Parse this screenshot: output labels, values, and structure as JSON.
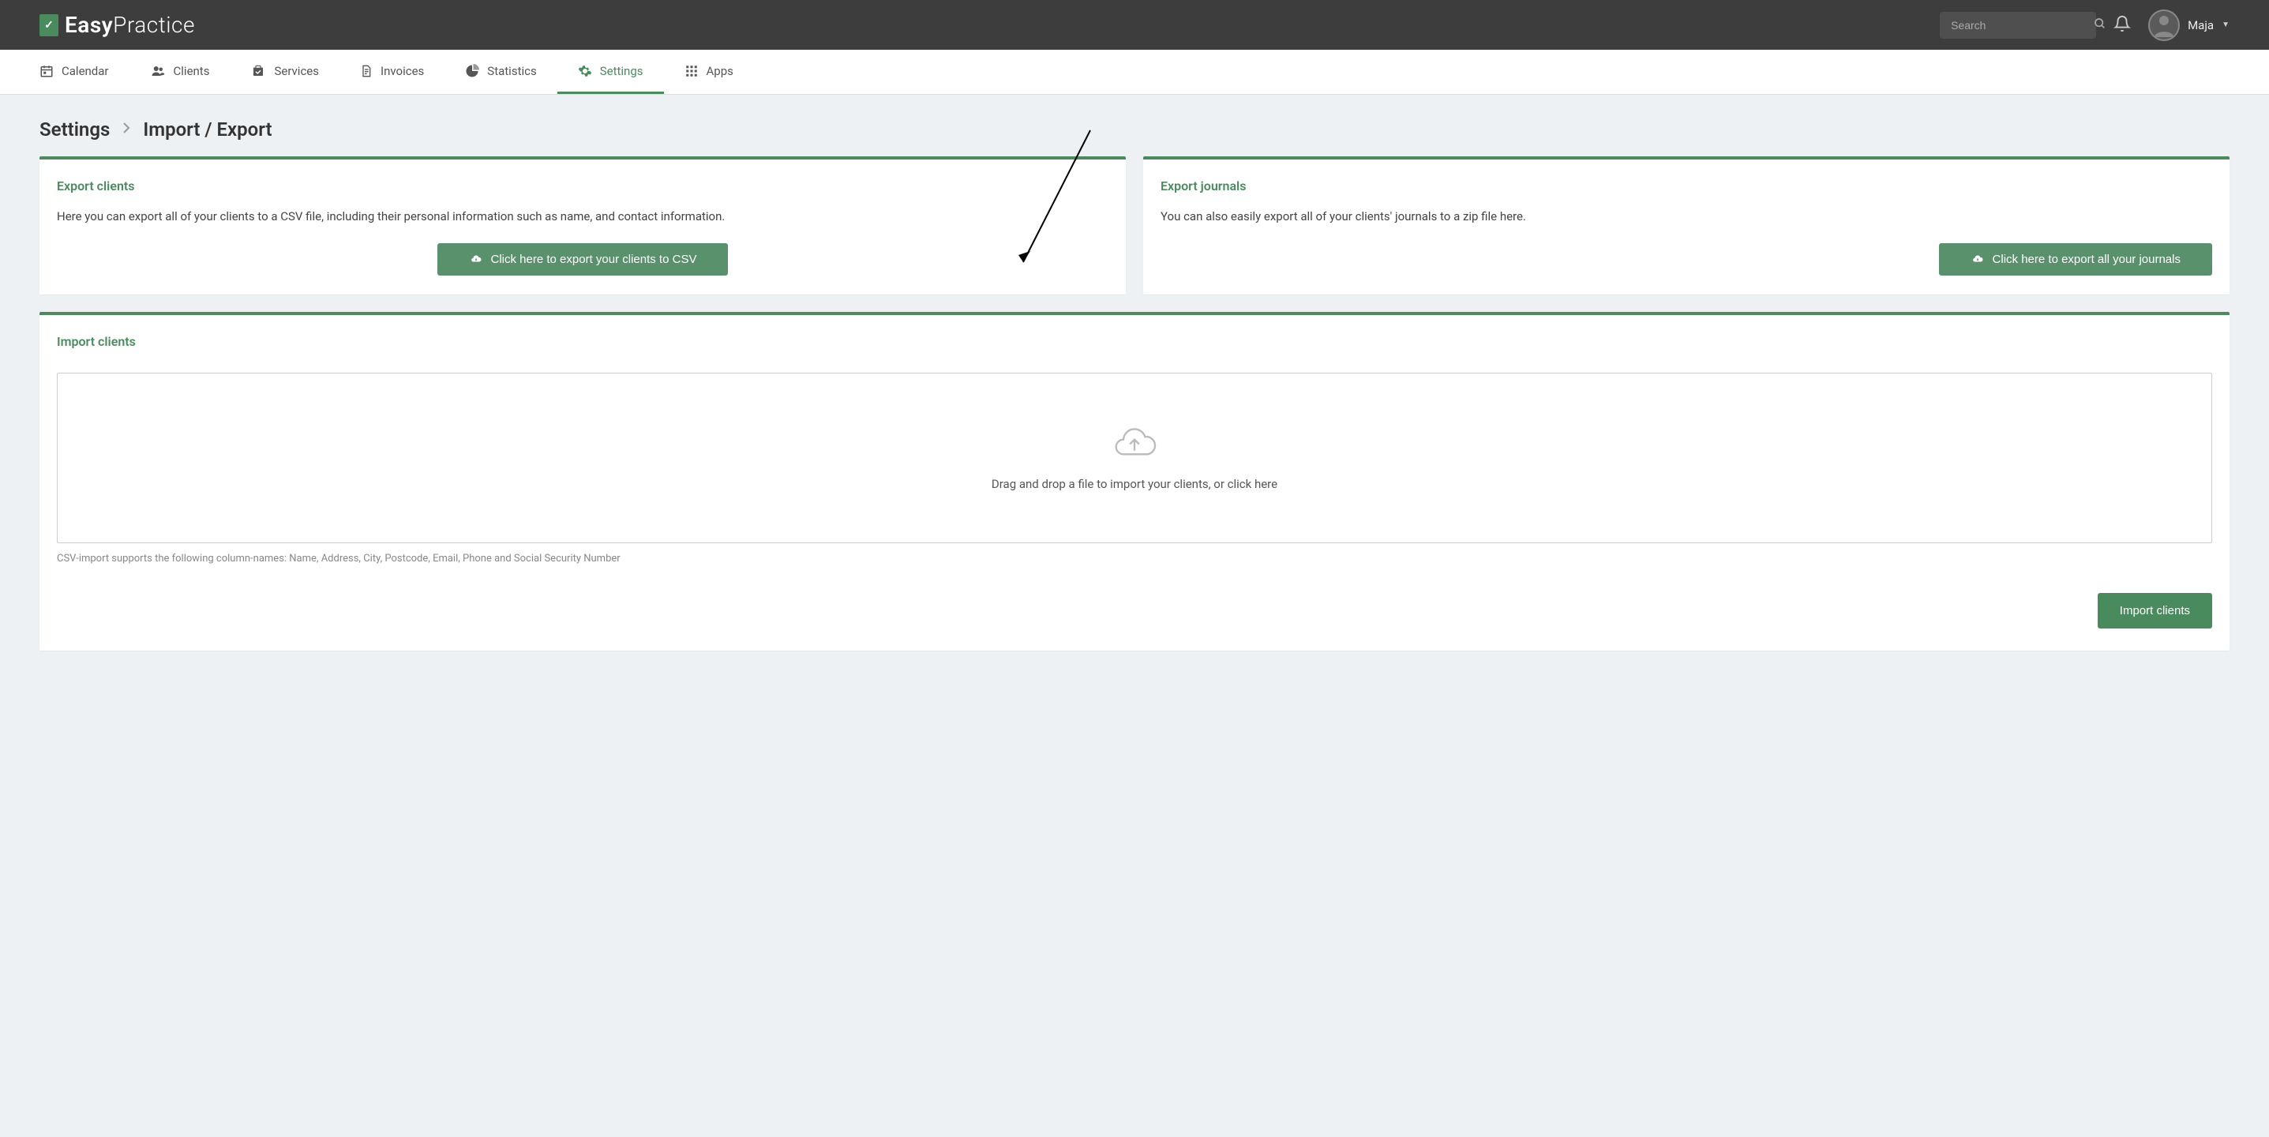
{
  "header": {
    "brand_bold": "Easy",
    "brand_light": "Practice",
    "search_placeholder": "Search",
    "user_name": "Maja"
  },
  "nav": {
    "calendar": "Calendar",
    "clients": "Clients",
    "services": "Services",
    "invoices": "Invoices",
    "statistics": "Statistics",
    "settings": "Settings",
    "apps": "Apps"
  },
  "breadcrumb": {
    "root": "Settings",
    "current": "Import / Export"
  },
  "export_clients": {
    "title": "Export clients",
    "text": "Here you can export all of your clients to a CSV file, including their personal information such as name, and contact information.",
    "button": "Click here to export your clients to CSV"
  },
  "export_journals": {
    "title": "Export journals",
    "text": "You can also easily export all of your clients' journals to a zip file here.",
    "button": "Click here to export all your journals"
  },
  "import_clients": {
    "title": "Import clients",
    "dropzone_text": "Drag and drop a file to import your clients, or click here",
    "csv_note": "CSV-import supports the following column-names: Name, Address, City, Postcode, Email, Phone and Social Security Number",
    "button": "Import clients"
  }
}
